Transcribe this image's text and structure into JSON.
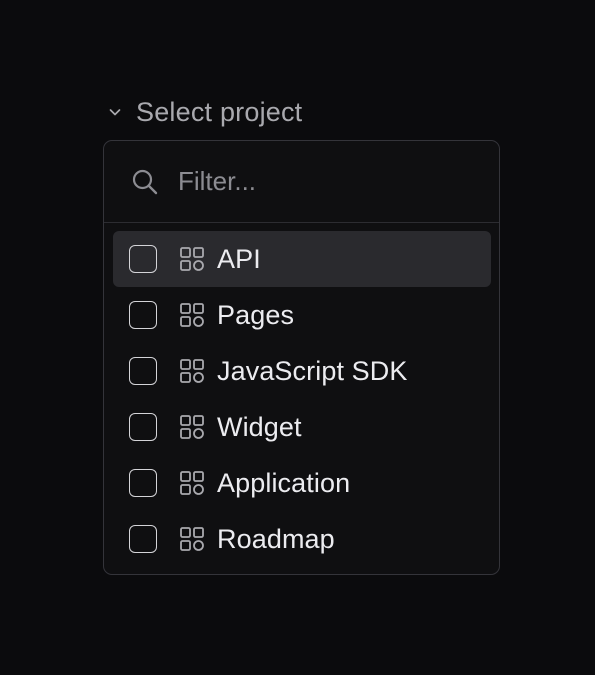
{
  "trigger": {
    "label": "Select project",
    "icon": "chevron-down-icon"
  },
  "search": {
    "placeholder": "Filter...",
    "value": "",
    "icon": "search-icon"
  },
  "items": [
    {
      "label": "API",
      "checked": false,
      "highlighted": true,
      "icon": "grid-icon"
    },
    {
      "label": "Pages",
      "checked": false,
      "highlighted": false,
      "icon": "grid-icon"
    },
    {
      "label": "JavaScript SDK",
      "checked": false,
      "highlighted": false,
      "icon": "grid-icon"
    },
    {
      "label": "Widget",
      "checked": false,
      "highlighted": false,
      "icon": "grid-icon"
    },
    {
      "label": "Application",
      "checked": false,
      "highlighted": false,
      "icon": "grid-icon"
    },
    {
      "label": "Roadmap",
      "checked": false,
      "highlighted": false,
      "icon": "grid-icon"
    }
  ],
  "colors": {
    "background": "#0b0b0d",
    "panel_border": "#34343a",
    "highlight": "#2a2a2e",
    "text_primary": "#ececf0",
    "text_muted": "#a9a9ae"
  }
}
